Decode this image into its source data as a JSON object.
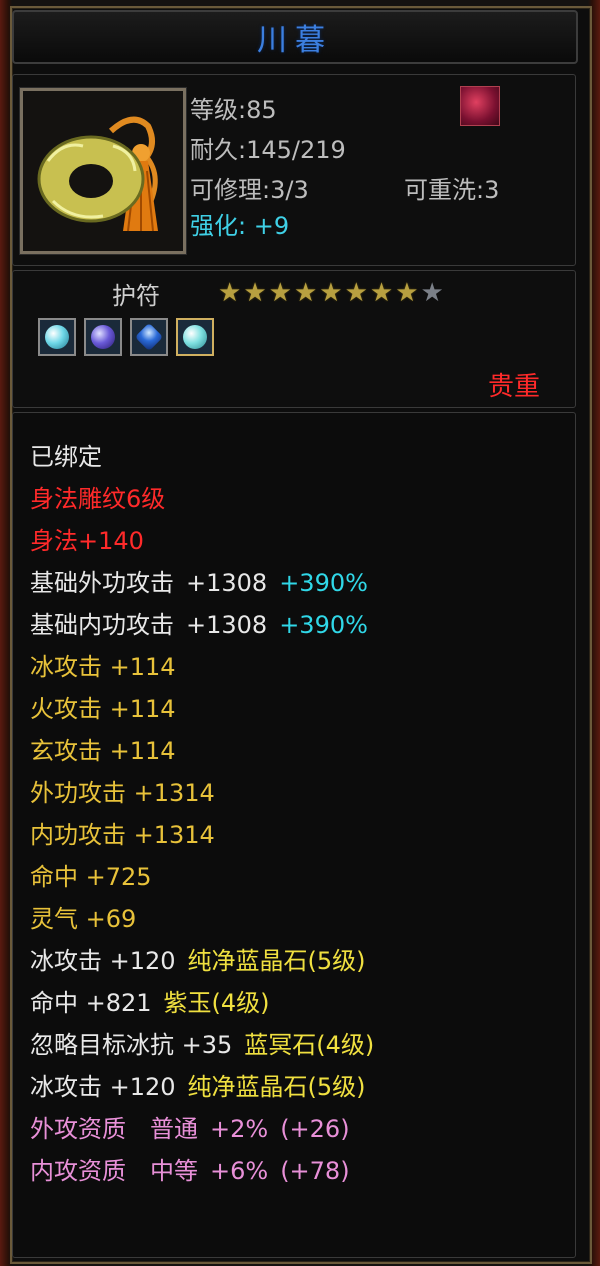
{
  "title": "川暮",
  "header": {
    "level": "等级:85",
    "durability": "耐久:145/219",
    "repair": "可修理:3/3",
    "rewash": "可重洗:3",
    "enhance": "强化: +9"
  },
  "type_label": "护符",
  "stars": {
    "filled": 8,
    "total": 9
  },
  "gems": [
    "cyan-orb-gem-icon",
    "purple-gem-icon",
    "blue-crystal-gem-icon",
    "cyan-orb-gem-icon"
  ],
  "quality": "贵重",
  "attributes": {
    "bound": "已绑定",
    "engrave": "身法雕纹6级",
    "agility": "身法+140",
    "base_ext_atk": {
      "label": "基础外功攻击",
      "value": "+1308",
      "pct": "+390%"
    },
    "base_int_atk": {
      "label": "基础内功攻击",
      "value": "+1308",
      "pct": "+390%"
    },
    "ice_atk": "冰攻击 +114",
    "fire_atk": "火攻击 +114",
    "xuan_atk": "玄攻击 +114",
    "ext_atk": "外功攻击 +1314",
    "int_atk": "内功攻击 +1314",
    "hit": "命中 +725",
    "spirit": "灵气 +69",
    "gem_line1": {
      "stat": "冰攻击 +120",
      "gem": "纯净蓝晶石(5级)"
    },
    "gem_line2": {
      "stat": "命中 +821",
      "gem": "紫玉(4级)"
    },
    "gem_line3": {
      "stat": "忽略目标冰抗 +35",
      "gem": "蓝冥石(4级)"
    },
    "gem_line4": {
      "stat": "冰攻击 +120",
      "gem": "纯净蓝晶石(5级)"
    },
    "aptitude_ext": {
      "label": "外攻资质",
      "grade": "普通",
      "value": "+2%",
      "bonus": "(+26)"
    },
    "aptitude_int": {
      "label": "内攻资质",
      "grade": "中等",
      "value": "+6%",
      "bonus": "(+78)"
    }
  }
}
